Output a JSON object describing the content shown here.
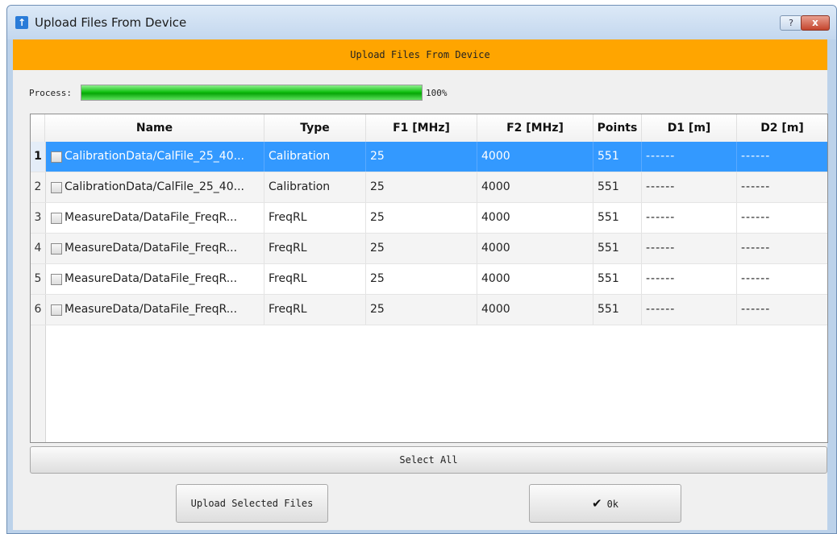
{
  "window": {
    "title": "Upload Files From Device",
    "help_glyph": "?",
    "close_glyph": "x"
  },
  "banner": {
    "text": "Upload Files From Device",
    "color": "#ffa500"
  },
  "process": {
    "label": "Process:",
    "progress": 1.0,
    "percent_text": "100%"
  },
  "table": {
    "columns": [
      "Name",
      "Type",
      "F1 [MHz]",
      "F2 [MHz]",
      "Points",
      "D1 [m]",
      "D2 [m]"
    ],
    "rows": [
      {
        "num": "1",
        "name": "CalibrationData/CalFile_25_40...",
        "type": "Calibration",
        "f1": "25",
        "f2": "4000",
        "points": "551",
        "d1": "------",
        "d2": "------"
      },
      {
        "num": "2",
        "name": "CalibrationData/CalFile_25_40...",
        "type": "Calibration",
        "f1": "25",
        "f2": "4000",
        "points": "551",
        "d1": "------",
        "d2": "------"
      },
      {
        "num": "3",
        "name": "MeasureData/DataFile_FreqR...",
        "type": "FreqRL",
        "f1": "25",
        "f2": "4000",
        "points": "551",
        "d1": "------",
        "d2": "------"
      },
      {
        "num": "4",
        "name": "MeasureData/DataFile_FreqR...",
        "type": "FreqRL",
        "f1": "25",
        "f2": "4000",
        "points": "551",
        "d1": "------",
        "d2": "------"
      },
      {
        "num": "5",
        "name": "MeasureData/DataFile_FreqR...",
        "type": "FreqRL",
        "f1": "25",
        "f2": "4000",
        "points": "551",
        "d1": "------",
        "d2": "------"
      },
      {
        "num": "6",
        "name": "MeasureData/DataFile_FreqR...",
        "type": "FreqRL",
        "f1": "25",
        "f2": "4000",
        "points": "551",
        "d1": "------",
        "d2": "------"
      }
    ],
    "selected_row": 1,
    "selection_color": "#3399ff"
  },
  "buttons": {
    "select_all": "Select All",
    "upload_selected": "Upload Selected Files",
    "ok": "0k",
    "ok_icon": "check-icon"
  }
}
